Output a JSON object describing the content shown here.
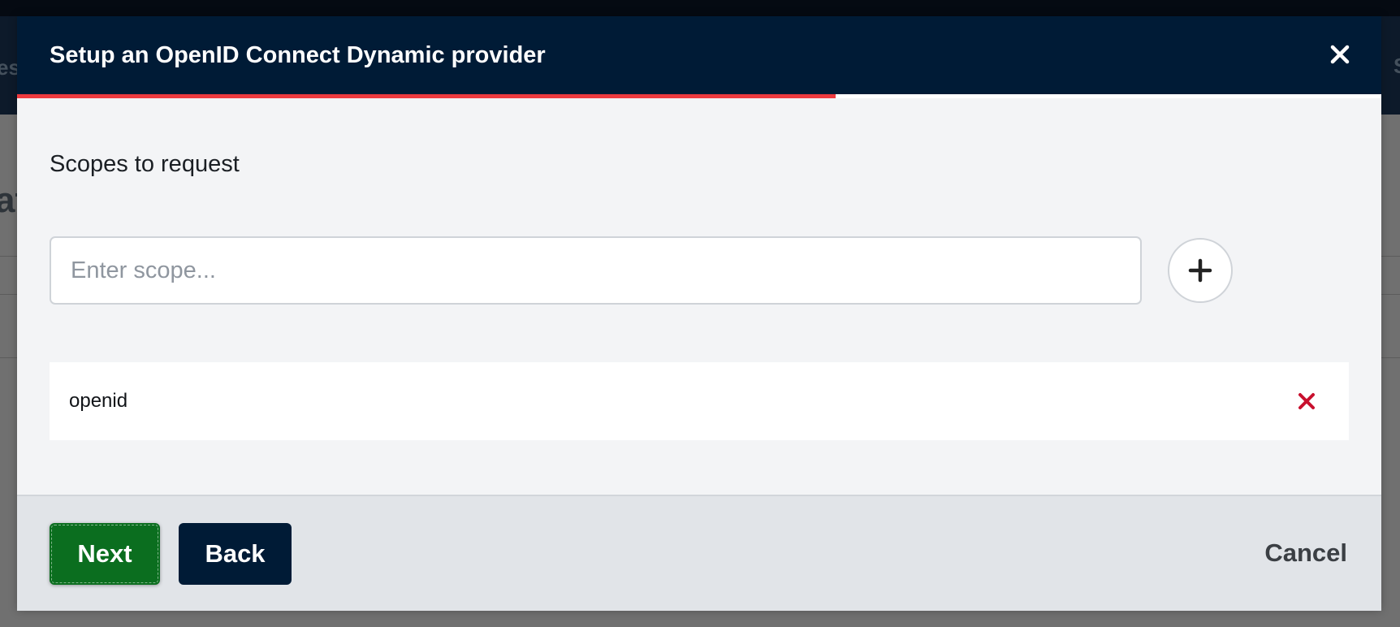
{
  "background": {
    "fragment_left": "es",
    "fragment_right": "S",
    "fragment_heading": "at"
  },
  "modal": {
    "title": "Setup an OpenID Connect Dynamic provider",
    "close_icon": "close-icon",
    "progress_fraction": 0.6,
    "progress_color": "#ee3a3f",
    "header_color": "#001b36"
  },
  "body": {
    "section_title": "Scopes to request",
    "scope_input": {
      "placeholder": "Enter scope...",
      "value": ""
    },
    "add_icon": "plus-icon",
    "scopes": [
      {
        "label": "openid",
        "remove_icon": "remove-x-icon"
      }
    ]
  },
  "footer": {
    "next_label": "Next",
    "back_label": "Back",
    "cancel_label": "Cancel",
    "next_color": "#0b6e1f",
    "back_color": "#001b36"
  }
}
